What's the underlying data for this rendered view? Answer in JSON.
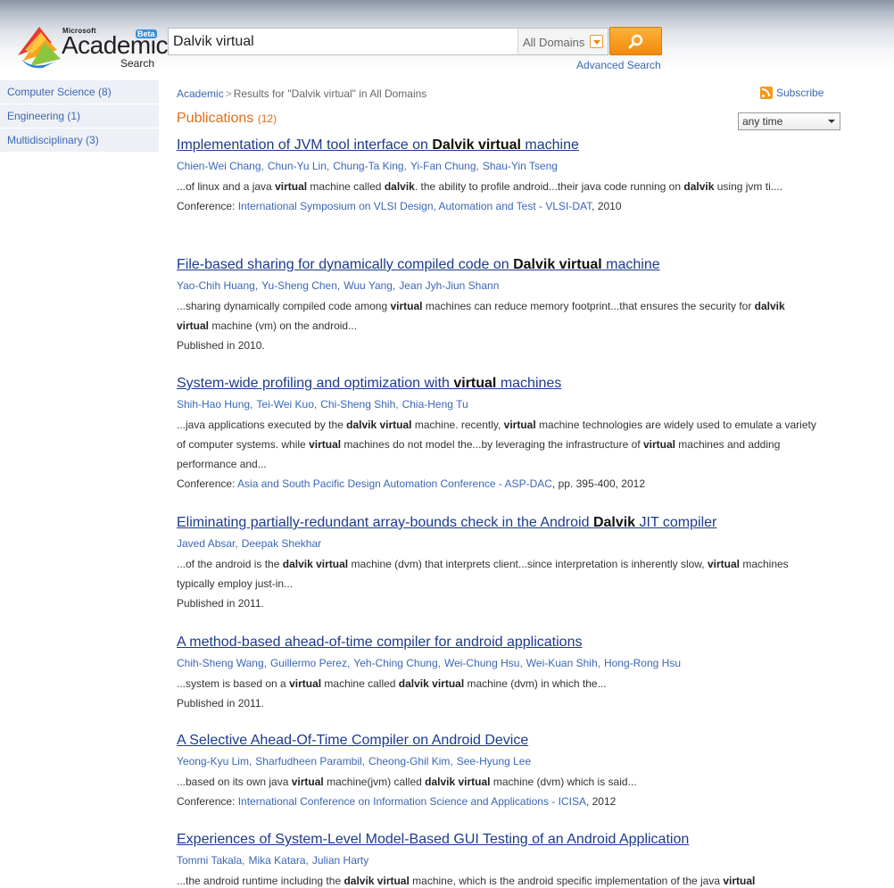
{
  "logo": {
    "ms": "Microsoft",
    "academic": "Academic",
    "search": "Search",
    "beta": "Beta"
  },
  "search": {
    "query": "Dalvik virtual",
    "domain": "All Domains",
    "advanced": "Advanced Search"
  },
  "sidebar": {
    "items": [
      {
        "label": "Computer Science (8)"
      },
      {
        "label": "Engineering (1)"
      },
      {
        "label": "Multidisciplinary (3)"
      }
    ]
  },
  "breadcrumb": {
    "home": "Academic",
    "sep": ">",
    "current": "Results for \"Dalvik virtual\" in All Domains"
  },
  "subscribe": "Subscribe",
  "publications": {
    "label": "Publications",
    "count": "(12)"
  },
  "time_filter": "any time",
  "results": [
    {
      "title": [
        [
          "Implementation of JVM tool interface on ",
          0
        ],
        [
          "Dalvik virtual",
          1
        ],
        [
          " machine",
          0
        ]
      ],
      "authors": [
        "Chien-Wei Chang,",
        "Chun-Yu Lin,",
        "Chung-Ta King,",
        "Yi-Fan Chung,",
        "Shau-Yin Tseng"
      ],
      "snippet": [
        [
          "...of linux and a java ",
          0
        ],
        [
          "virtual",
          1
        ],
        [
          " machine called ",
          0
        ],
        [
          "dalvik",
          1
        ],
        [
          ". the ability to profile android...their java code running on ",
          0
        ],
        [
          "dalvik",
          1
        ],
        [
          " using jvm ti....",
          0
        ]
      ],
      "venue_prefix": "Conference: ",
      "venue_name": "International Symposium on VLSI Design, Automation and Test - VLSI-DAT",
      "venue_suffix": ", 2010"
    },
    {
      "title": [
        [
          "File-based sharing for dynamically compiled code on ",
          0
        ],
        [
          "Dalvik virtual",
          1
        ],
        [
          " machine",
          0
        ]
      ],
      "authors": [
        "Yao-Chih Huang,",
        "Yu-Sheng Chen,",
        "Wuu Yang,",
        "Jean Jyh-Jiun Shann"
      ],
      "snippet": [
        [
          "...sharing dynamically compiled code among ",
          0
        ],
        [
          "virtual",
          1
        ],
        [
          " machines can reduce memory footprint...that ensures the security for ",
          0
        ],
        [
          "dalvik virtual",
          1
        ],
        [
          " machine (vm) on the android...",
          0
        ]
      ],
      "venue_prefix": "Published in 2010.",
      "venue_name": "",
      "venue_suffix": ""
    },
    {
      "title": [
        [
          "System-wide profiling and optimization with ",
          0
        ],
        [
          "virtual",
          1
        ],
        [
          " machines",
          0
        ]
      ],
      "authors": [
        "Shih-Hao Hung,",
        "Tei-Wei Kuo,",
        "Chi-Sheng Shih,",
        "Chia-Heng Tu"
      ],
      "snippet": [
        [
          "...java applications executed by the ",
          0
        ],
        [
          "dalvik virtual",
          1
        ],
        [
          " machine. recently, ",
          0
        ],
        [
          "virtual",
          1
        ],
        [
          " machine technologies are widely used to emulate a variety of computer systems. while ",
          0
        ],
        [
          "virtual",
          1
        ],
        [
          " machines do not model the...by leveraging the infrastructure of ",
          0
        ],
        [
          "virtual",
          1
        ],
        [
          " machines and adding performance and...",
          0
        ]
      ],
      "venue_prefix": "Conference: ",
      "venue_name": "Asia and South Pacific Design Automation Conference - ASP-DAC",
      "venue_suffix": ", pp. 395-400, 2012"
    },
    {
      "title": [
        [
          "Eliminating partially-redundant array-bounds check in the Android ",
          0
        ],
        [
          "Dalvik",
          1
        ],
        [
          " JIT compiler",
          0
        ]
      ],
      "authors": [
        "Javed Absar,",
        "Deepak Shekhar"
      ],
      "snippet": [
        [
          "...of the android is the ",
          0
        ],
        [
          "dalvik virtual",
          1
        ],
        [
          " machine (dvm) that interprets client...since interpretation is inherently slow, ",
          0
        ],
        [
          "virtual",
          1
        ],
        [
          " machines typically employ just-in...",
          0
        ]
      ],
      "venue_prefix": "Published in 2011.",
      "venue_name": "",
      "venue_suffix": ""
    },
    {
      "title": [
        [
          "A method-based ahead-of-time compiler for android applications",
          0
        ]
      ],
      "authors": [
        "Chih-Sheng Wang,",
        "Guillermo Perez,",
        "Yeh-Ching Chung,",
        "Wei-Chung Hsu,",
        "Wei-Kuan Shih,",
        "Hong-Rong Hsu"
      ],
      "snippet": [
        [
          "...system is based on a ",
          0
        ],
        [
          "virtual",
          1
        ],
        [
          " machine called ",
          0
        ],
        [
          "dalvik virtual",
          1
        ],
        [
          " machine (dvm) in which the...",
          0
        ]
      ],
      "venue_prefix": "Published in 2011.",
      "venue_name": "",
      "venue_suffix": ""
    },
    {
      "title": [
        [
          "A Selective Ahead-Of-Time Compiler on Android Device",
          0
        ]
      ],
      "authors": [
        "Yeong-Kyu Lim,",
        "Sharfudheen Parambil,",
        "Cheong-Ghil Kim,",
        "See-Hyung Lee"
      ],
      "snippet": [
        [
          "...based on its own java ",
          0
        ],
        [
          "virtual",
          1
        ],
        [
          " machine(jvm) called ",
          0
        ],
        [
          "dalvik virtual",
          1
        ],
        [
          " machine (dvm) which is said...",
          0
        ]
      ],
      "venue_prefix": "Conference: ",
      "venue_name": "International Conference on Information Science and Applications - ICISA",
      "venue_suffix": ", 2012"
    },
    {
      "title": [
        [
          "Experiences of System-Level Model-Based GUI Testing of an Android Application",
          0
        ]
      ],
      "authors": [
        "Tommi Takala,",
        "Mika Katara,",
        "Julian Harty"
      ],
      "snippet": [
        [
          "...the android runtime including the ",
          0
        ],
        [
          "dalvik virtual",
          1
        ],
        [
          " machine, which is the android specific implementation of the java ",
          0
        ],
        [
          "virtual",
          1
        ]
      ],
      "venue_prefix": "",
      "venue_name": "",
      "venue_suffix": ""
    }
  ]
}
